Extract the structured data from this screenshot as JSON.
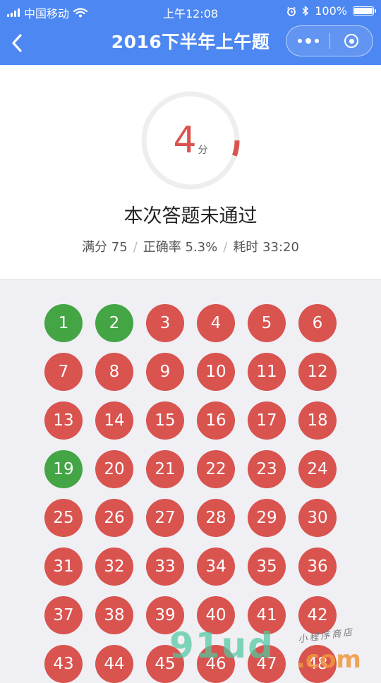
{
  "status_bar": {
    "carrier": "中国移动",
    "time": "上午12:08",
    "battery": "100%",
    "battery_level": 1.0
  },
  "nav": {
    "title": "2016下半年上午题"
  },
  "result": {
    "score": "4",
    "score_unit": "分",
    "score_fraction": 0.053,
    "verdict": "本次答题未通过",
    "full_score": "满分 75",
    "accuracy": "正确率 5.3%",
    "time_used": "耗时 33:20",
    "separator": "/"
  },
  "questions": [
    {
      "n": "1",
      "correct": true
    },
    {
      "n": "2",
      "correct": true
    },
    {
      "n": "3",
      "correct": false
    },
    {
      "n": "4",
      "correct": false
    },
    {
      "n": "5",
      "correct": false
    },
    {
      "n": "6",
      "correct": false
    },
    {
      "n": "7",
      "correct": false
    },
    {
      "n": "8",
      "correct": false
    },
    {
      "n": "9",
      "correct": false
    },
    {
      "n": "10",
      "correct": false
    },
    {
      "n": "11",
      "correct": false
    },
    {
      "n": "12",
      "correct": false
    },
    {
      "n": "13",
      "correct": false
    },
    {
      "n": "14",
      "correct": false
    },
    {
      "n": "15",
      "correct": false
    },
    {
      "n": "16",
      "correct": false
    },
    {
      "n": "17",
      "correct": false
    },
    {
      "n": "18",
      "correct": false
    },
    {
      "n": "19",
      "correct": true
    },
    {
      "n": "20",
      "correct": false
    },
    {
      "n": "21",
      "correct": false
    },
    {
      "n": "22",
      "correct": false
    },
    {
      "n": "23",
      "correct": false
    },
    {
      "n": "24",
      "correct": false
    },
    {
      "n": "25",
      "correct": false
    },
    {
      "n": "26",
      "correct": false
    },
    {
      "n": "27",
      "correct": false
    },
    {
      "n": "28",
      "correct": false
    },
    {
      "n": "29",
      "correct": false
    },
    {
      "n": "30",
      "correct": false
    },
    {
      "n": "31",
      "correct": false
    },
    {
      "n": "32",
      "correct": false
    },
    {
      "n": "33",
      "correct": false
    },
    {
      "n": "34",
      "correct": false
    },
    {
      "n": "35",
      "correct": false
    },
    {
      "n": "36",
      "correct": false
    },
    {
      "n": "37",
      "correct": false
    },
    {
      "n": "38",
      "correct": false
    },
    {
      "n": "39",
      "correct": false
    },
    {
      "n": "40",
      "correct": false
    },
    {
      "n": "41",
      "correct": false
    },
    {
      "n": "42",
      "correct": false
    },
    {
      "n": "43",
      "correct": false
    },
    {
      "n": "44",
      "correct": false
    },
    {
      "n": "45",
      "correct": false
    },
    {
      "n": "46",
      "correct": false
    },
    {
      "n": "47",
      "correct": false
    },
    {
      "n": "48",
      "correct": false
    }
  ],
  "colors": {
    "nav_bg": "#4d87f1",
    "wrong": "#d9534f",
    "correct": "#43a544"
  },
  "watermark": {
    "main": "91ud",
    "dotcom": ".com",
    "small": "小程序商店"
  }
}
